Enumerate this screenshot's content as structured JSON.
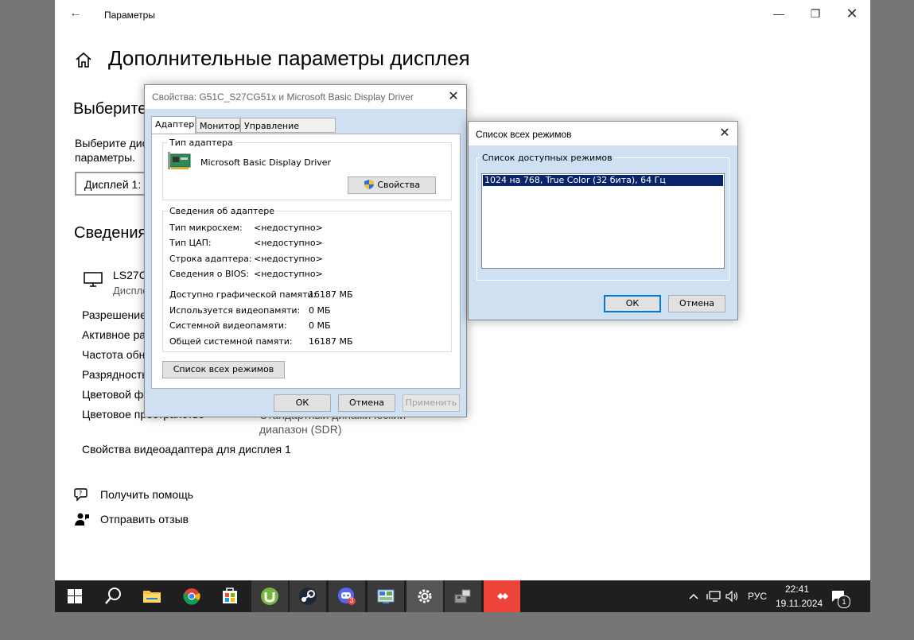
{
  "settings": {
    "window_title": "Параметры",
    "page_title": "Дополнительные параметры дисплея",
    "choose_heading": "Выберите",
    "choose_text_1": "Выберите дис",
    "choose_text_2": "параметры.",
    "display_combo": "Дисплей 1: L",
    "info_heading": "Сведения",
    "monitor_name": "LS27C",
    "monitor_sub": "Диспле",
    "rows": [
      {
        "label": "Разрешение",
        "value": ""
      },
      {
        "label": "Активное ра",
        "value": ""
      },
      {
        "label": "Частота обн",
        "value": ""
      },
      {
        "label": "Разрядность",
        "value": ""
      },
      {
        "label": "Цветовой фо",
        "value": ""
      },
      {
        "label": "Цветовое пространство",
        "value": "Стандартный динамический"
      }
    ],
    "value_line2": "диапазон (SDR)",
    "adapter_link": "Свойства видеоадаптера для дисплея 1",
    "help_link": "Получить помощь",
    "feedback_link": "Отправить отзыв"
  },
  "props_dialog": {
    "title": "Свойства: G51C_S27CG51x и Microsoft Basic Display Driver",
    "tabs": [
      "Адаптер",
      "Монитор",
      "Управление цветом"
    ],
    "adapter_type_legend": "Тип адаптера",
    "adapter_name": "Microsoft Basic Display Driver",
    "properties_button": "Свойства",
    "info_legend": "Сведения об адаптере",
    "info_rows": [
      {
        "label": "Тип микросхем:",
        "value": "<недоступно>"
      },
      {
        "label": "Тип ЦАП:",
        "value": "<недоступно>"
      },
      {
        "label": "Строка адаптера:",
        "value": "<недоступно>"
      },
      {
        "label": "Сведения о BIOS:",
        "value": "<недоступно>"
      }
    ],
    "memory_rows": [
      {
        "label": "Доступно графической памяти:",
        "value": "16187 МБ"
      },
      {
        "label": "Используется видеопамяти:",
        "value": "0 МБ"
      },
      {
        "label": "Системной видеопамяти:",
        "value": "0 МБ"
      },
      {
        "label": "Общей системной памяти:",
        "value": "16187 МБ"
      }
    ],
    "list_modes_button": "Список всех режимов",
    "ok": "ОК",
    "cancel": "Отмена",
    "apply": "Применить"
  },
  "modes_dialog": {
    "title": "Список всех режимов",
    "group_label": "Список доступных режимов",
    "modes": [
      "1024 на 768, True Color (32 бита), 64 Гц"
    ],
    "ok": "ОК",
    "cancel": "Отмена"
  },
  "taskbar": {
    "items": [
      "windows-start",
      "search",
      "file-explorer",
      "chrome",
      "microsoft-store",
      "utorrent",
      "steam",
      "discord",
      "control-panel",
      "settings",
      "device-manager",
      "anydesk"
    ],
    "discord_badge": "3",
    "language": "РУС",
    "time": "22:41",
    "date": "19.11.2024",
    "notification_count": "1"
  }
}
